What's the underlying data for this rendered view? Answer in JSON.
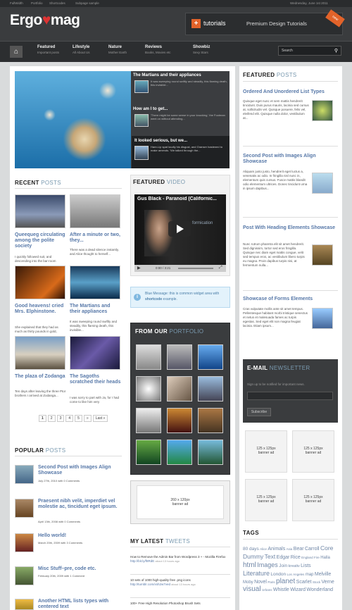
{
  "topbar": {
    "links": [
      "FullWidth",
      "Portfolio",
      "Shortcodes",
      "Subpage sample"
    ],
    "date": "Wednesday, June 1st 2011"
  },
  "brand": {
    "logo_a": "Ergo",
    "logo_b": "mag",
    "tutorials": "tutorials",
    "premium": "Premium Design Tutorials",
    "new": "new"
  },
  "nav": {
    "items": [
      {
        "label": "Featured",
        "sub": "Important posts"
      },
      {
        "label": "Lifestyle",
        "sub": "All About Us"
      },
      {
        "label": "Nature",
        "sub": "Mother Earth"
      },
      {
        "label": "Reviews",
        "sub": "Books, Movies etc"
      },
      {
        "label": "Showbiz",
        "sub": "Sexy Stars"
      }
    ],
    "search_placeholder": "Search"
  },
  "slider": {
    "items": [
      {
        "title": "The Martians and their appliances",
        "text": "It was sweeping round swiftly and steadily, this flaming death, this invisible..."
      },
      {
        "title": "How am I to get...",
        "text": "'There might be some sense in your knocking,' the Footman went on without attending..."
      },
      {
        "title": "It looked serious, but we...",
        "text": "Hare-Lip spat loudly his disgust, and Granser hastened to make amends. 'We talked through the..."
      }
    ]
  },
  "recent": {
    "title_a": "RECENT",
    "title_b": "POSTS",
    "posts": [
      {
        "title": "Queequeg circulating among the polite society",
        "text": "I quickly followed suit, and descending into the bar-room"
      },
      {
        "title": "After a minute or two, they...",
        "text": "There was a dead silence instantly, and Alice thought to herself..."
      },
      {
        "title": "Good heavens! cried Mrs. Elphinstone.",
        "text": "She explained that they had as much as thirty pounds in gold,"
      },
      {
        "title": "The Martians and their appliances",
        "text": "It was sweeping round swiftly and steadily, this flaming death, this invisible..."
      },
      {
        "title": "The plaza of Zodanga",
        "text": "Ten days after leaving the three Ptor brothers I arrived at Zodanga..."
      },
      {
        "title": "The Sagoths scratched their heads",
        "text": "I was sorry to part with Ja, for I had come to like him very"
      }
    ],
    "pages": [
      "1",
      "2",
      "3",
      "4",
      "5",
      "»",
      "Last »"
    ]
  },
  "video": {
    "title_a": "FEATURED",
    "title_b": "VIDEO",
    "name": "Gus Black - Paranoid (Californic...",
    "overlay": "formication",
    "time": "0:00 / 3:21"
  },
  "blue_msg": {
    "text_a": "Blue Message: this is common widget area with ",
    "bold": "shortcode",
    "text_b": " example."
  },
  "portfolio": {
    "title_a": "FROM OUR",
    "title_b": "PORTFOLIO"
  },
  "banner_main": {
    "size": "260 x 120px",
    "label": "banner ad"
  },
  "popular": {
    "title_a": "POPULAR",
    "title_b": "POSTS",
    "posts": [
      {
        "title": "Second Post with Images Align Showcase",
        "meta": "July 27th, 2010 with 0 Comments"
      },
      {
        "title": "Praesent nibh velit, imperdiet vel molestie ac, tincidunt eget ipsum.",
        "meta": "April 13th, 2008 with 0 Comments"
      },
      {
        "title": "Hello world!",
        "meta": "March 20th, 2009 with 3 Comments"
      },
      {
        "title": "Misc Stuff–pre, code etc.",
        "meta": "February 20th, 2009 with 1 Comment"
      },
      {
        "title": "Another HTML lists types with centered text",
        "meta": ""
      }
    ]
  },
  "tweets": {
    "title_a": "MY LATEST",
    "title_b": "TWEETS",
    "items": [
      {
        "text": "How to Remove the Admin Bar from Wordpress 3 + - Mozilla Firefox",
        "link": "http://bit.ly/f8RdE",
        "time": "about 13 hours ago"
      },
      {
        "text": "10 sets of 1000 high-quality free .png icons",
        "link": "http://tumblr.com/xsh2w7ved",
        "time": "about 13 hours ago"
      },
      {
        "text": "100+ Free High Resolution Photoshop Brush Sets",
        "link": "",
        "time": ""
      }
    ]
  },
  "featured": {
    "title_a": "FEATURED",
    "title_b": "POSTS",
    "posts": [
      {
        "title": "Ordered And Unordered List Types",
        "text": "Quisque eget nunc et sem mattis hendrerit tincidunt. Duis purus mauris, lacinia sed cursus at, sollicitudin vel. Quisque posuere, felis vel, eleifend elit. Quisque nulla dolor, vestibulum at..."
      },
      {
        "title": "Second Post with Images Align Showcase",
        "text": "Aliquam justo justo, hendrerit eget luctus a, venenatis ac odio. In fringilla nisl nunc in, elementum quis cursus. Fusce mattis blandit odio elementum ultrices. Donec tincidunt urna in ipsum dapibus..."
      },
      {
        "title": "Post With Heading Elements Showcase",
        "text": "Nunc rutrum pharetra elit sit amet hendrerit. Sed dignissim, tortor sed eros fringilla. Quisque nec diam eget mattis congue, velit sed tempus eros, ac vestibulum libero turpis eu magna. Proin dapibus turpis nisi, at fermentum nulla..."
      },
      {
        "title": "Showcase of Forms Elements",
        "text": "Cras vulputate mollis ante sit amet tempus. Pellentesque habitant morbi tristique senectus et netus et malesuada fames ac turpis egestas. Sed eget elit non magna feugiat lacinia. Etiam ipsum..."
      }
    ]
  },
  "newsletter": {
    "title_a": "E-MAIL",
    "title_b": "NEWSLETTER",
    "text": "Sign up to be notified for important news.",
    "button": "Subscribe"
  },
  "banners": [
    {
      "size": "125 x 125px",
      "label": "banner ad"
    },
    {
      "size": "125 x 125px",
      "label": "banner ad"
    },
    {
      "size": "125 x 125px",
      "label": "banner ad"
    },
    {
      "size": "125 x 125px",
      "label": "banner ad"
    }
  ],
  "tags": {
    "title": "TAGS",
    "items": [
      "80 days",
      "Alice",
      "Animals",
      "Asia",
      "Bear",
      "Carroll",
      "Core",
      "Dummy",
      "Text",
      "Edgar",
      "Rice",
      "England",
      "Fire",
      "Halla",
      "html",
      "Images",
      "Join",
      "kreativ",
      "Lists",
      "Literature",
      "London",
      "Los",
      "Angeles",
      "map",
      "Melville",
      "Moby",
      "Novel",
      "Paris",
      "planet",
      "Scarlet",
      "Stock",
      "Verne",
      "visual",
      "Urbans",
      "Whistle",
      "Wizard",
      "Wonderland"
    ]
  }
}
